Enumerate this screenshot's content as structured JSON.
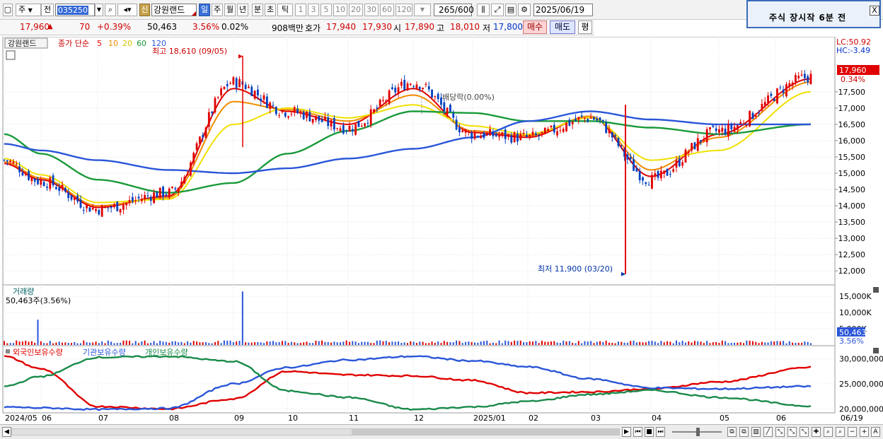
{
  "toolbar": {
    "market_label": "주",
    "prefix_label": "전",
    "stock_code": "035250",
    "credit_badge": "신",
    "stock_name": "강원랜드",
    "period_buttons": [
      "일",
      "주",
      "월",
      "년",
      "분",
      "초",
      "틱"
    ],
    "interval_buttons": [
      "1",
      "3",
      "5",
      "10",
      "20",
      "30",
      "60",
      "120"
    ],
    "count_value": "265",
    "count_total": "/600",
    "date_value": "2025/06/19"
  },
  "notice": {
    "text": "주식 장시작   6분 전",
    "close_label": "X"
  },
  "quote": {
    "price": "17,960",
    "change": "70",
    "change_pct": "+0.39%",
    "volume": "50,463",
    "volume_pct": "3.56%",
    "turnover_pct": "0.02%",
    "amount": "908백만",
    "ask_label": "호가",
    "ask_price": "17,940",
    "bid_price": "17,930",
    "open_label": "시",
    "open": "17,890",
    "high_label": "고",
    "high": "18,010",
    "low_label": "저",
    "low": "17,800",
    "buy_label": "매수",
    "sell_label": "매도",
    "avg_label": "평"
  },
  "legend": {
    "name": "강원랜드",
    "ma_title": "종가 단순",
    "ma_periods": [
      "5",
      "10",
      "20",
      "60",
      "120"
    ],
    "ma_colors": [
      "#e00000",
      "#f08c00",
      "#f0e000",
      "#1a9a3a",
      "#2a55d8"
    ]
  },
  "annotations": {
    "high_text": "최고 18,610 (09/05)",
    "low_text": "최저 11,900 (03/20)",
    "dividend_text": "배당락(0.00%)",
    "lc": "LC:50.92",
    "hc": "HC:-3.49",
    "last_price_tag": "17,960",
    "last_pct_tag": "0.34%"
  },
  "price_axis": [
    "17,500",
    "17,000",
    "16,500",
    "16,000",
    "15,500",
    "15,000",
    "14,500",
    "14,000",
    "13,500",
    "13,000",
    "12,500",
    "12,000"
  ],
  "volume_panel": {
    "title": "거래량",
    "summary": "50,463주(3.56%)",
    "axis": [
      "15,000K",
      "10,000K",
      "5,000K"
    ],
    "last_tag": "50,463",
    "last_pct": "3.56%"
  },
  "holdings_panel": {
    "series_labels": [
      "외국인보유수량",
      "기관보유수량",
      "개인보유수량"
    ],
    "series_colors": [
      "#e00000",
      "#2a55d8",
      "#1a8a4a"
    ],
    "axis": [
      "30,000,000",
      "25,000,000",
      "20,000,000"
    ]
  },
  "date_axis": [
    "2024/05",
    "06",
    "07",
    "08",
    "09",
    "10",
    "11",
    "12",
    "2025/01",
    "02",
    "03",
    "04",
    "05",
    "06"
  ],
  "date_end": "06/19",
  "chart_data": [
    {
      "type": "candlestick",
      "title": "강원랜드",
      "ylim": [
        11700,
        18800
      ],
      "x": [
        "2024/05",
        "06",
        "07",
        "08",
        "09",
        "10",
        "11",
        "12",
        "2025/01",
        "02",
        "03",
        "04",
        "05",
        "06"
      ],
      "close": [
        15400,
        14750,
        13900,
        14400,
        17800,
        16900,
        16400,
        17800,
        16200,
        16100,
        16700,
        14800,
        16300,
        17960
      ],
      "series": [
        {
          "name": "5",
          "values": [
            15300,
            14800,
            13950,
            14300,
            17600,
            16900,
            16500,
            17600,
            16250,
            16100,
            16750,
            14900,
            16200,
            17900
          ]
        },
        {
          "name": "10",
          "values": [
            15350,
            14850,
            14000,
            14250,
            17200,
            16950,
            16600,
            17400,
            16300,
            16150,
            16750,
            15100,
            16100,
            17800
          ]
        },
        {
          "name": "20",
          "values": [
            15450,
            14950,
            14100,
            14200,
            16500,
            17000,
            16700,
            17100,
            16450,
            16200,
            16700,
            15400,
            15700,
            17500
          ]
        },
        {
          "name": "60",
          "values": [
            16200,
            15600,
            14800,
            14400,
            14700,
            15600,
            16300,
            16900,
            16850,
            16600,
            16600,
            16400,
            16200,
            16500
          ]
        },
        {
          "name": "120",
          "values": [
            15900,
            15700,
            15400,
            15100,
            15000,
            15150,
            15450,
            15750,
            16100,
            16600,
            16900,
            16650,
            16500,
            16500
          ]
        }
      ],
      "max": {
        "value": 18610,
        "date": "09/05"
      },
      "min": {
        "value": 11900,
        "date": "03/20"
      }
    },
    {
      "type": "bar",
      "title": "거래량",
      "ylim": [
        0,
        17000000
      ],
      "highlights": [
        {
          "x": "2024/05",
          "value": 7800000
        },
        {
          "x": "09",
          "value": 16500000
        }
      ],
      "last": 50463
    },
    {
      "type": "line",
      "ylim": [
        19500000,
        31500000
      ],
      "x": [
        "2024/05",
        "06",
        "07",
        "08",
        "09",
        "10",
        "11",
        "12",
        "2025/01",
        "02",
        "03",
        "04",
        "05",
        "06"
      ],
      "series": [
        {
          "name": "외국인보유수량",
          "values": [
            30500000,
            28000000,
            20500000,
            20000000,
            22000000,
            27500000,
            26800000,
            26600000,
            25700000,
            23200000,
            23400000,
            24000000,
            25400000,
            28300000
          ]
        },
        {
          "name": "기관보유수량",
          "values": [
            20400000,
            20200000,
            19900000,
            20100000,
            25000000,
            28300000,
            29800000,
            30500000,
            29600000,
            28400000,
            26000000,
            24200000,
            24000000,
            24500000
          ]
        },
        {
          "name": "개인보유수량",
          "values": [
            24500000,
            26500000,
            30300000,
            30500000,
            29500000,
            23600000,
            22300000,
            19900000,
            20400000,
            21500000,
            22900000,
            23700000,
            22300000,
            20600000
          ]
        }
      ]
    }
  ]
}
